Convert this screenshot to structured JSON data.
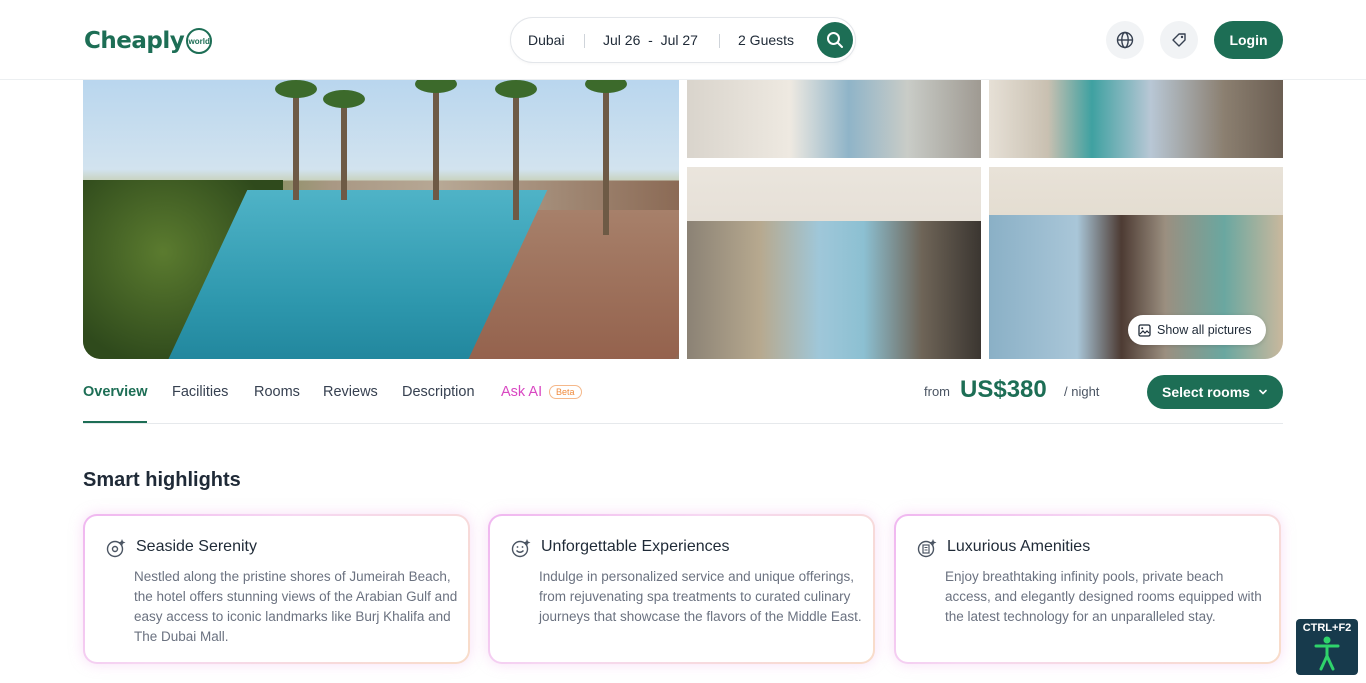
{
  "header": {
    "logo_text": "Cheaply",
    "logo_sub": "world",
    "search": {
      "city": "Dubai",
      "dates": "Jul 26  -  Jul 27",
      "guests": "2 Guests"
    },
    "language_icon": "globe-icon",
    "currency_icon": "tag-icon",
    "login_label": "Login"
  },
  "gallery": {
    "show_all_label": "Show all pictures"
  },
  "tabs": {
    "overview": "Overview",
    "facilities": "Facilities",
    "rooms": "Rooms",
    "reviews": "Reviews",
    "description": "Description",
    "ask_ai": "Ask AI",
    "beta": "Beta"
  },
  "price": {
    "from": "from",
    "value": "US$380",
    "per_night": "/ night",
    "select_rooms": "Select rooms"
  },
  "highlights": {
    "title": "Smart highlights",
    "cards": [
      {
        "title": "Seaside Serenity",
        "text": "Nestled along the pristine shores of Jumeirah Beach, the hotel offers stunning views of the Arabian Gulf and easy access to iconic landmarks like Burj Khalifa and The Dubai Mall.",
        "icon": "location-sparkle-icon"
      },
      {
        "title": "Unforgettable Experiences",
        "text": "Indulge in personalized service and unique offerings, from rejuvenating spa treatments to curated culinary journeys that showcase the flavors of the Middle East.",
        "icon": "smile-sparkle-icon"
      },
      {
        "title": "Luxurious Amenities",
        "text": "Enjoy breathtaking infinity pools, private beach access, and elegantly designed rooms equipped with the latest technology for an unparalleled stay.",
        "icon": "building-sparkle-icon"
      }
    ]
  },
  "accessibility": {
    "shortcut": "CTRL+F2"
  },
  "colors": {
    "brand": "#1d6e55",
    "ai_accent": "#d947c2",
    "beta_accent": "#f08b3d"
  }
}
